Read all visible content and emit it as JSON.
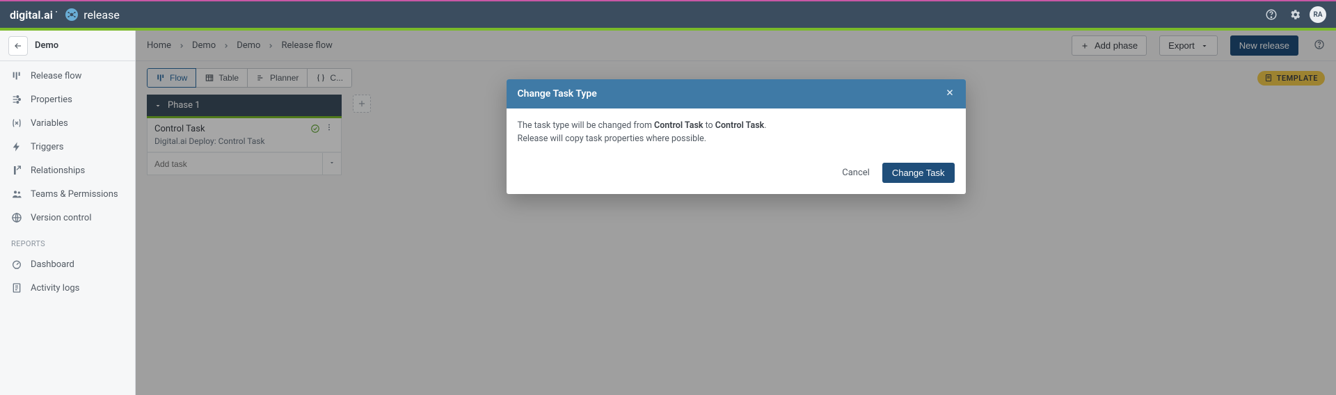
{
  "brand": {
    "name": "digital.ai",
    "product": "release"
  },
  "topbar": {
    "avatar_initials": "RA"
  },
  "sidebar": {
    "title": "Demo",
    "items": [
      {
        "label": "Release flow"
      },
      {
        "label": "Properties"
      },
      {
        "label": "Variables"
      },
      {
        "label": "Triggers"
      },
      {
        "label": "Relationships"
      },
      {
        "label": "Teams & Permissions"
      },
      {
        "label": "Version control"
      }
    ],
    "reports_label": "REPORTS",
    "reports": [
      {
        "label": "Dashboard"
      },
      {
        "label": "Activity logs"
      }
    ]
  },
  "header": {
    "breadcrumbs": [
      "Home",
      "Demo",
      "Demo",
      "Release flow"
    ],
    "add_phase": "Add phase",
    "export": "Export",
    "new_release": "New release"
  },
  "toolbar": {
    "views": [
      "Flow",
      "Table",
      "Planner",
      "C..."
    ],
    "template_badge": "TEMPLATE"
  },
  "board": {
    "phase": {
      "title": "Phase 1",
      "task": {
        "title": "Control Task",
        "subtitle": "Digital.ai Deploy: Control Task"
      },
      "add_task_placeholder": "Add task"
    }
  },
  "modal": {
    "title": "Change Task Type",
    "line1_prefix": "The task type will be changed from ",
    "from_type": "Control Task",
    "line1_mid": " to ",
    "to_type": "Control Task",
    "line1_suffix": ".",
    "line2": "Release will copy task properties where possible.",
    "cancel": "Cancel",
    "confirm": "Change Task"
  }
}
